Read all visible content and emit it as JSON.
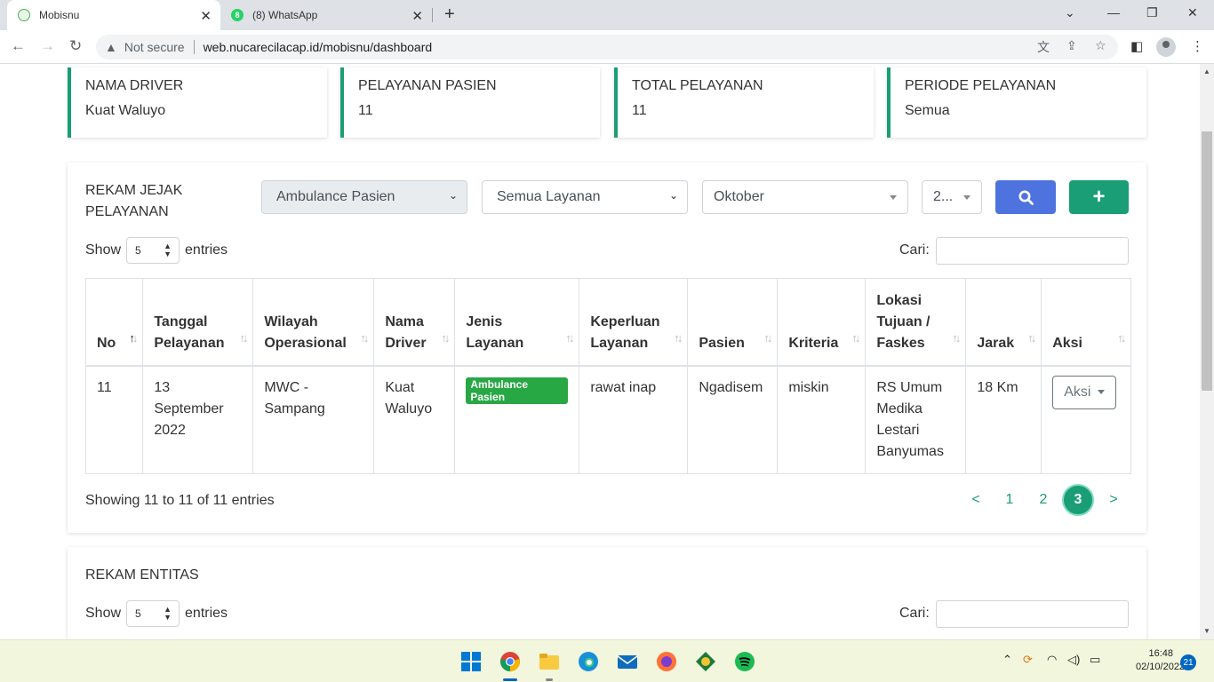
{
  "browser": {
    "tabs": [
      {
        "title": "Mobisnu",
        "active": true
      },
      {
        "title": "(8) WhatsApp",
        "active": false
      }
    ],
    "address": {
      "security_label": "Not secure",
      "url": "web.nucarecilacap.id/mobisnu/dashboard"
    }
  },
  "stats": [
    {
      "label": "NAMA DRIVER",
      "value": "Kuat Waluyo"
    },
    {
      "label": "PELAYANAN PASIEN",
      "value": "11"
    },
    {
      "label": "TOTAL PELAYANAN",
      "value": "11"
    },
    {
      "label": "PERIODE PELAYANAN",
      "value": "Semua"
    }
  ],
  "rekam_jejak": {
    "title_line1": "REKAM JEJAK",
    "title_line2": "PELAYANAN",
    "filters": {
      "jenis": "Ambulance Pasien",
      "layanan": "Semua Layanan",
      "bulan": "Oktober",
      "tahun": "2..."
    },
    "show_label": "Show",
    "entries_label": "entries",
    "page_length": "5",
    "search_label": "Cari:",
    "columns": [
      {
        "line1": "",
        "line2": "",
        "line3": "No"
      },
      {
        "line1": "",
        "line2": "Tanggal",
        "line3": "Pelayanan"
      },
      {
        "line1": "",
        "line2": "Wilayah",
        "line3": "Operasional"
      },
      {
        "line1": "",
        "line2": "Nama",
        "line3": "Driver"
      },
      {
        "line1": "",
        "line2": "Jenis",
        "line3": "Layanan"
      },
      {
        "line1": "",
        "line2": "Keperluan",
        "line3": "Layanan"
      },
      {
        "line1": "",
        "line2": "",
        "line3": "Pasien"
      },
      {
        "line1": "",
        "line2": "",
        "line3": "Kriteria"
      },
      {
        "line1": "Lokasi",
        "line2": "Tujuan /",
        "line3": "Faskes"
      },
      {
        "line1": "",
        "line2": "",
        "line3": "Jarak"
      },
      {
        "line1": "",
        "line2": "",
        "line3": "Aksi"
      }
    ],
    "row": {
      "no": "11",
      "tanggal_1": "13",
      "tanggal_2": "September",
      "tanggal_3": "2022",
      "wilayah_1": "MWC -",
      "wilayah_2": "Sampang",
      "driver_1": "Kuat",
      "driver_2": "Waluyo",
      "jenis": "Ambulance Pasien",
      "keperluan": "rawat inap",
      "pasien": "Ngadisem",
      "kriteria": "miskin",
      "lokasi_1": "RS Umum",
      "lokasi_2": "Medika",
      "lokasi_3": "Lestari",
      "lokasi_4": "Banyumas",
      "jarak": "18 Km",
      "aksi": "Aksi"
    },
    "info": "Showing 11 to 11 of 11 entries",
    "pagination": {
      "prev": "<",
      "pages": [
        "1",
        "2",
        "3"
      ],
      "current": "3",
      "next": ">"
    }
  },
  "rekam_entitas": {
    "title": "REKAM ENTITAS",
    "show_label": "Show",
    "entries_label": "entries",
    "page_length": "5",
    "search_label": "Cari:"
  },
  "taskbar": {
    "time": "16:48",
    "date": "02/10/2022",
    "notifications": "21"
  },
  "colors": {
    "accent_green": "#1a9e76",
    "search_button": "#4e73df",
    "badge_green": "#28a745"
  }
}
